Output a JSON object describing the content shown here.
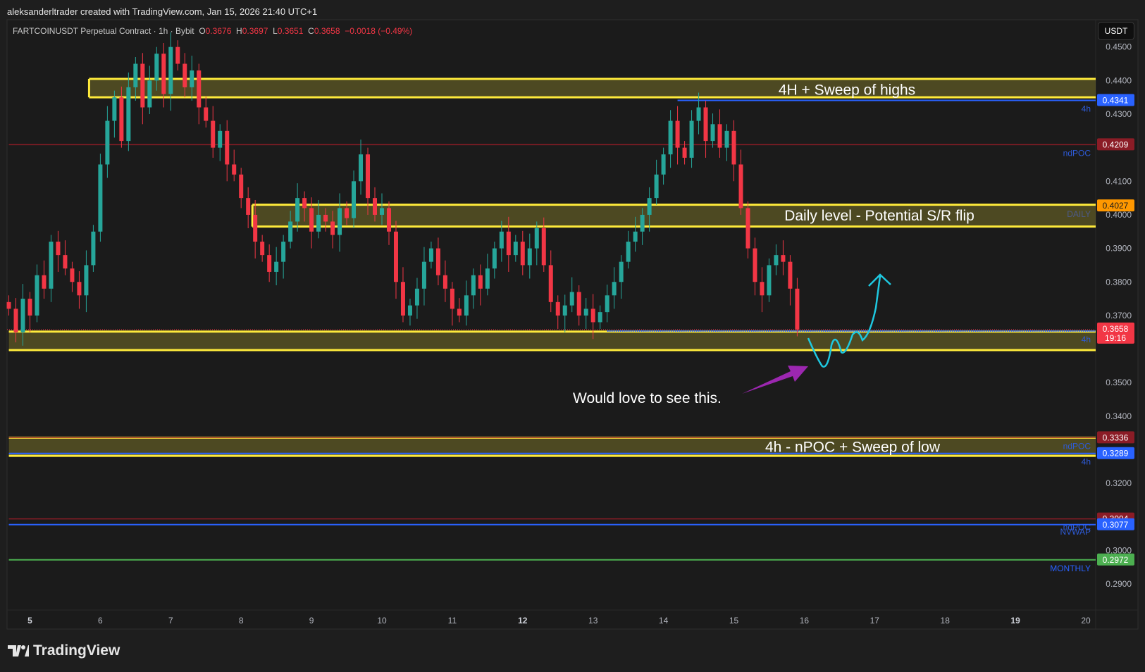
{
  "credit": "aleksanderltrader created with TradingView.com, Jan 15, 2026 21:40 UTC+1",
  "symbol": {
    "name": "FARTCOINUSDT Perpetual Contract · 1h · Bybit",
    "o_label": "O",
    "o": "0.3676",
    "h_label": "H",
    "h": "0.3697",
    "l_label": "L",
    "l": "0.3651",
    "c_label": "C",
    "c": "0.3658",
    "change": "−0.0018 (−0.49%)"
  },
  "currency_button": "USDT",
  "brand": "TradingView",
  "colors": {
    "up": "#26a69a",
    "down": "#f23645",
    "zone": "#ffeb3b",
    "blue": "#2962ff",
    "red": "#8b1c26",
    "green": "#4caf50",
    "orange": "#ff9800",
    "cyan": "#1ec8e0",
    "purple": "#9c27b0"
  },
  "chart_data": {
    "type": "candlestick",
    "title": "FARTCOINUSDT Perpetual Contract · 1h · Bybit",
    "x_start_day": 4.7,
    "x_step_day": 0.1,
    "closes": [
      0.372,
      0.365,
      0.375,
      0.37,
      0.382,
      0.378,
      0.392,
      0.388,
      0.384,
      0.38,
      0.376,
      0.385,
      0.395,
      0.415,
      0.428,
      0.435,
      0.422,
      0.438,
      0.445,
      0.432,
      0.44,
      0.448,
      0.436,
      0.45,
      0.445,
      0.438,
      0.443,
      0.432,
      0.428,
      0.42,
      0.425,
      0.415,
      0.412,
      0.405,
      0.4,
      0.392,
      0.388,
      0.383,
      0.386,
      0.392,
      0.398,
      0.405,
      0.402,
      0.395,
      0.4,
      0.398,
      0.394,
      0.402,
      0.399,
      0.41,
      0.418,
      0.405,
      0.4,
      0.402,
      0.395,
      0.38,
      0.37,
      0.373,
      0.378,
      0.386,
      0.39,
      0.382,
      0.378,
      0.372,
      0.37,
      0.376,
      0.382,
      0.378,
      0.384,
      0.39,
      0.395,
      0.388,
      0.392,
      0.385,
      0.39,
      0.396,
      0.385,
      0.374,
      0.37,
      0.373,
      0.377,
      0.37,
      0.372,
      0.368,
      0.371,
      0.376,
      0.38,
      0.386,
      0.392,
      0.395,
      0.4,
      0.405,
      0.412,
      0.418,
      0.428,
      0.42,
      0.417,
      0.428,
      0.432,
      0.422,
      0.427,
      0.42,
      0.425,
      0.415,
      0.402,
      0.39,
      0.38,
      0.376,
      0.385,
      0.388,
      0.386,
      0.378,
      0.3658
    ],
    "ylim": [
      0.283,
      0.455
    ],
    "xlim_days": [
      4.7,
      20.15
    ],
    "y_ticks": [
      "0.4500",
      "0.4400",
      "0.4300",
      "0.4100",
      "0.4000",
      "0.3900",
      "0.3800",
      "0.3700",
      "0.3500",
      "0.3400",
      "0.3200",
      "0.3000",
      "0.2900"
    ],
    "x_ticks": [
      {
        "day": 5,
        "label": "5",
        "bold": true
      },
      {
        "day": 6,
        "label": "6"
      },
      {
        "day": 7,
        "label": "7"
      },
      {
        "day": 8,
        "label": "8"
      },
      {
        "day": 9,
        "label": "9"
      },
      {
        "day": 10,
        "label": "10"
      },
      {
        "day": 11,
        "label": "11"
      },
      {
        "day": 12,
        "label": "12",
        "bold": true
      },
      {
        "day": 13,
        "label": "13"
      },
      {
        "day": 14,
        "label": "14"
      },
      {
        "day": 15,
        "label": "15"
      },
      {
        "day": 16,
        "label": "16"
      },
      {
        "day": 17,
        "label": "17"
      },
      {
        "day": 18,
        "label": "18"
      },
      {
        "day": 19,
        "label": "19",
        "bold": true
      },
      {
        "day": 20,
        "label": "20"
      }
    ],
    "zones": [
      {
        "top": 0.4405,
        "bottom": 0.435,
        "from_day": 5.84,
        "label": "4H + Sweep of highs"
      },
      {
        "top": 0.403,
        "bottom": 0.3965,
        "from_day": 8.16,
        "label": "Daily level - Potential S/R flip"
      },
      {
        "top": 0.3652,
        "bottom": 0.3597,
        "from_day": 4.7,
        "label": ""
      },
      {
        "top": 0.3336,
        "bottom": 0.3282,
        "from_day": 4.7,
        "label": "4h - nPOC + Sweep of low"
      }
    ],
    "levels": [
      {
        "price": 0.4341,
        "label": "0.4341",
        "tag": "4h",
        "color": "blue",
        "from_day": 14.2
      },
      {
        "price": 0.4209,
        "label": "0.4209",
        "tag": "ndPOC",
        "color": "red",
        "from_day": 4.7
      },
      {
        "price": 0.4027,
        "label": "0.4027",
        "tag": "DAILY",
        "color": "orange",
        "from_day": 8.16
      },
      {
        "price": 0.3654,
        "label": "0.3654",
        "tag": "4h",
        "color": "blue",
        "from_day": 13.2
      },
      {
        "price": 0.3336,
        "label": "0.3336",
        "tag": "ndPOC",
        "color": "red",
        "from_day": 4.7
      },
      {
        "price": 0.3289,
        "label": "0.3289",
        "tag": "4h",
        "color": "blue",
        "from_day": 4.7
      },
      {
        "price": 0.3094,
        "label": "0.3094",
        "tag": "ndPOC",
        "color": "red",
        "from_day": 4.7
      },
      {
        "price": 0.3077,
        "label": "0.3077",
        "tag": "NVWAP",
        "color": "blue",
        "from_day": 4.7
      },
      {
        "price": 0.2972,
        "label": "0.2972",
        "tag": "MONTHLY",
        "color": "green",
        "from_day": 4.7
      }
    ],
    "current_price": {
      "price": 0.3658,
      "label": "0.3658",
      "countdown": "19:16"
    },
    "annotation": "Would love to see this."
  }
}
